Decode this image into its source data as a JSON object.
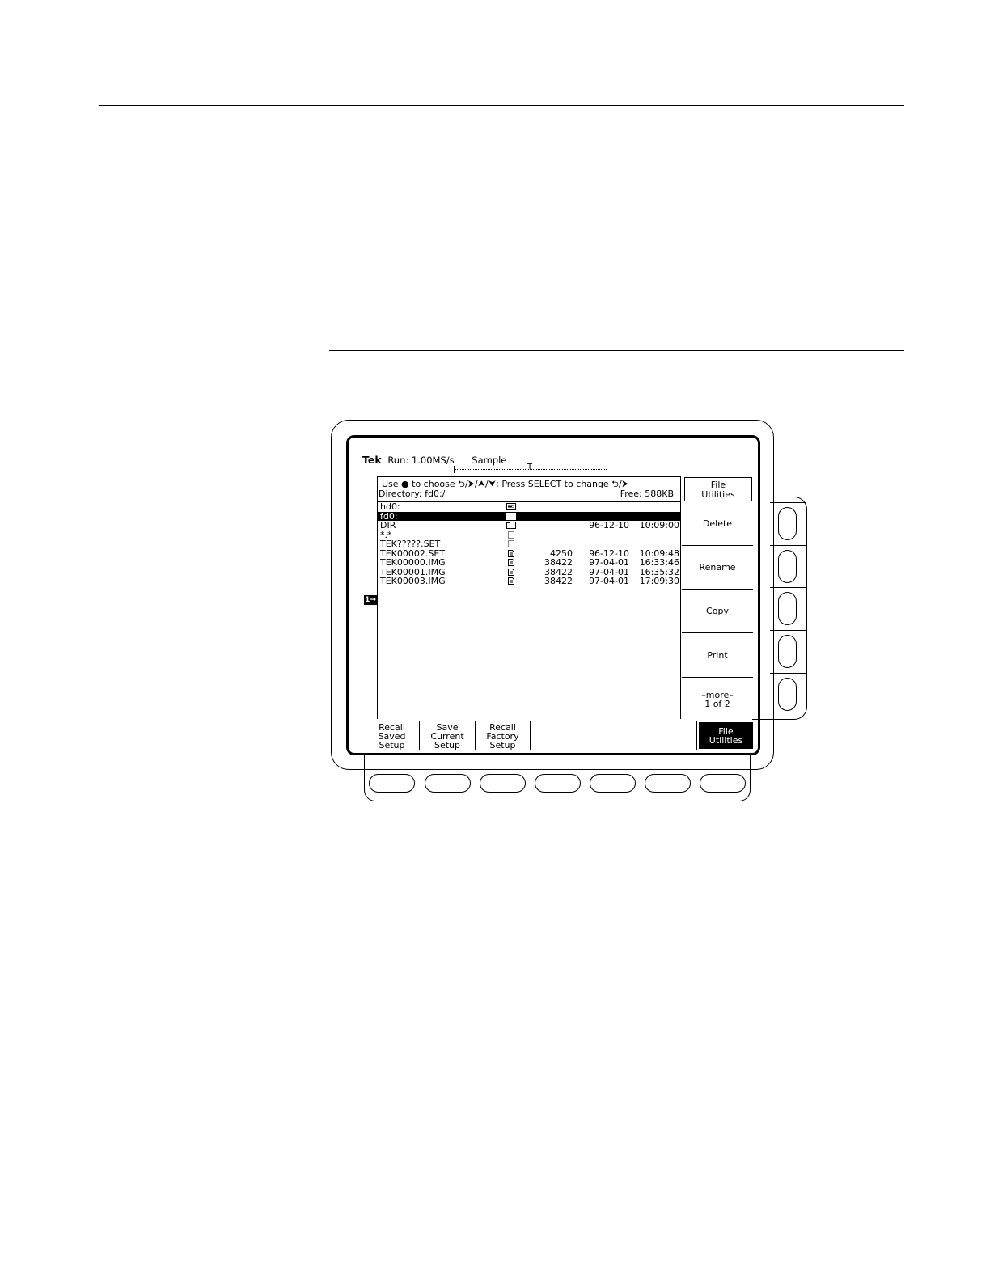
{
  "status": {
    "brand": "Tek",
    "run": "Run: 1.00MS/s",
    "mode": "Sample",
    "trigger_mark": "T"
  },
  "browser": {
    "instruction": "Use ● to choose ⮌/⮞/⮝/⮟; Press SELECT to change ⮌/⮞",
    "directory": "Directory: fd0:/",
    "free": "Free: 588KB",
    "rows": [
      {
        "name": "hd0:",
        "icon": "drive-icon",
        "size": "",
        "date": "",
        "time": "",
        "selected": false
      },
      {
        "name": "fd0:",
        "icon": "drive-icon",
        "size": "",
        "date": "",
        "time": "",
        "selected": true
      },
      {
        "name": "DIR",
        "icon": "folder-icon",
        "size": "",
        "date": "96-12-10",
        "time": "10:09:00",
        "selected": false
      },
      {
        "name": "*.*",
        "icon": "filter-icon",
        "size": "",
        "date": "",
        "time": "",
        "selected": false
      },
      {
        "name": "TEK?????.SET",
        "icon": "filter-icon",
        "size": "",
        "date": "",
        "time": "",
        "selected": false
      },
      {
        "name": "TEK00002.SET",
        "icon": "file-icon",
        "size": "4250",
        "date": "96-12-10",
        "time": "10:09:48",
        "selected": false
      },
      {
        "name": "TEK00000.IMG",
        "icon": "file-icon",
        "size": "38422",
        "date": "97-04-01",
        "time": "16:33:46",
        "selected": false
      },
      {
        "name": "TEK00001.IMG",
        "icon": "file-icon",
        "size": "38422",
        "date": "97-04-01",
        "time": "16:35:32",
        "selected": false
      },
      {
        "name": "TEK00003.IMG",
        "icon": "file-icon",
        "size": "38422",
        "date": "97-04-01",
        "time": "17:09:30",
        "selected": false
      }
    ]
  },
  "channel_marker": "1→",
  "side_menu": {
    "title_line1": "File",
    "title_line2": "Utilities",
    "items": [
      {
        "line1": "Delete",
        "line2": ""
      },
      {
        "line1": "Rename",
        "line2": ""
      },
      {
        "line1": "Copy",
        "line2": ""
      },
      {
        "line1": "Print",
        "line2": ""
      },
      {
        "line1": "–more–",
        "line2": "1 of 2"
      }
    ]
  },
  "bottom_menu": {
    "items": [
      {
        "l1": "Recall",
        "l2": "Saved",
        "l3": "Setup",
        "active": false
      },
      {
        "l1": "Save",
        "l2": "Current",
        "l3": "Setup",
        "active": false
      },
      {
        "l1": "Recall",
        "l2": "Factory",
        "l3": "Setup",
        "active": false
      },
      {
        "l1": "",
        "l2": "",
        "l3": "",
        "active": false
      },
      {
        "l1": "",
        "l2": "",
        "l3": "",
        "active": false
      },
      {
        "l1": "",
        "l2": "",
        "l3": "",
        "active": false
      },
      {
        "l1": "File",
        "l2": "Utilities",
        "l3": "",
        "active": true
      }
    ]
  }
}
